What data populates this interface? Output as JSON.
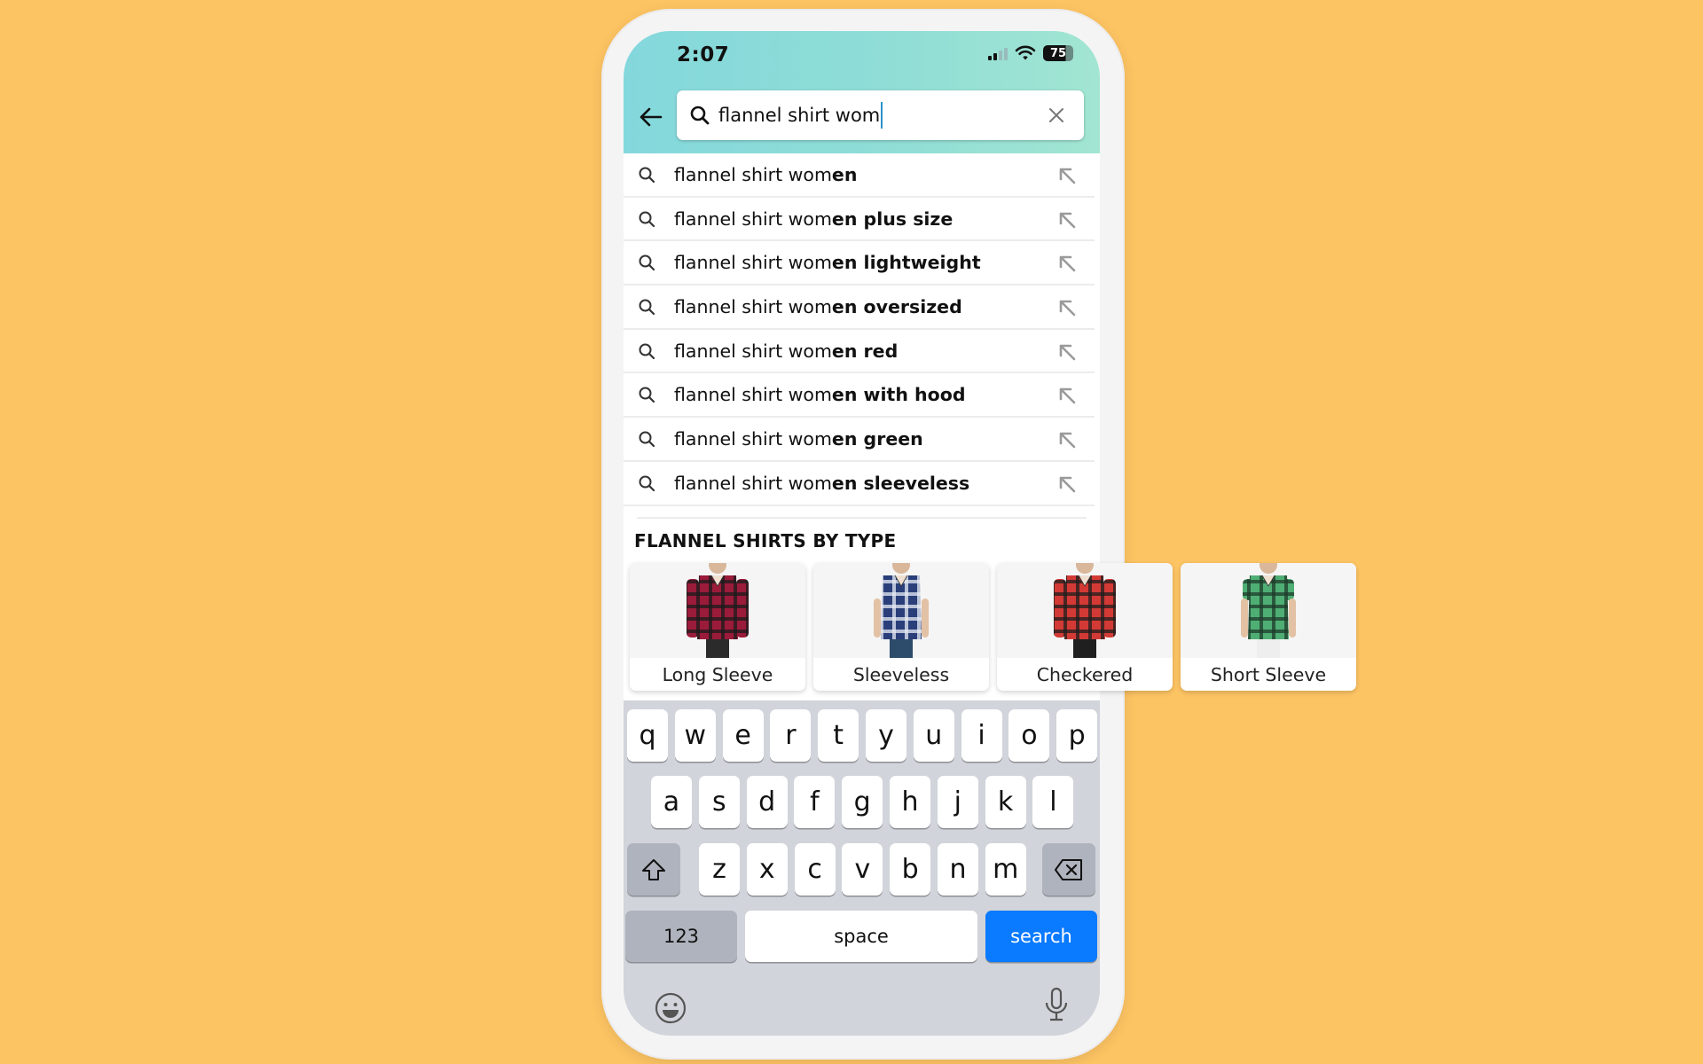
{
  "status_bar": {
    "time": "2:07",
    "battery": "75"
  },
  "search": {
    "value": "flannel shirt wom",
    "back_icon": "arrow-left-icon",
    "search_icon": "search-icon",
    "clear_icon": "close-icon"
  },
  "suggestions": [
    {
      "typed": "flannel shirt wom",
      "completion": "en"
    },
    {
      "typed": "flannel shirt wom",
      "completion": "en plus size"
    },
    {
      "typed": "flannel shirt wom",
      "completion": "en lightweight"
    },
    {
      "typed": "flannel shirt wom",
      "completion": "en oversized"
    },
    {
      "typed": "flannel shirt wom",
      "completion": "en red"
    },
    {
      "typed": "flannel shirt wom",
      "completion": "en with hood"
    },
    {
      "typed": "flannel shirt wom",
      "completion": "en green"
    },
    {
      "typed": "flannel shirt wom",
      "completion": "en sleeveless"
    }
  ],
  "section": {
    "title": "FLANNEL SHIRTS BY TYPE"
  },
  "categories": [
    {
      "label": "Long Sleeve",
      "shirt_color": "#9b1b3a",
      "plaid_color": "#1a1a1a",
      "pants_color": "#2b2b2b"
    },
    {
      "label": "Sleeveless",
      "shirt_color": "#2a3f7a",
      "plaid_color": "#e8ecf4",
      "pants_color": "#2d4b6b"
    },
    {
      "label": "Checkered",
      "shirt_color": "#d33a35",
      "plaid_color": "#1d1d1d",
      "pants_color": "#1f1f1f"
    },
    {
      "label": "Short Sleeve",
      "shirt_color": "#4fae74",
      "plaid_color": "#1d3a2a",
      "pants_color": "#eeeeee"
    }
  ],
  "keyboard": {
    "row1": [
      "q",
      "w",
      "e",
      "r",
      "t",
      "y",
      "u",
      "i",
      "o",
      "p"
    ],
    "row2": [
      "a",
      "s",
      "d",
      "f",
      "g",
      "h",
      "j",
      "k",
      "l"
    ],
    "row3": [
      "z",
      "x",
      "c",
      "v",
      "b",
      "n",
      "m"
    ],
    "numbers_label": "123",
    "space_label": "space",
    "search_label": "search"
  },
  "colors": {
    "background": "#FDC463",
    "header_gradient_start": "#84D8DC",
    "header_gradient_end": "#A2E5D2",
    "search_key": "#0A7AFF",
    "caret": "#2a92c8"
  }
}
